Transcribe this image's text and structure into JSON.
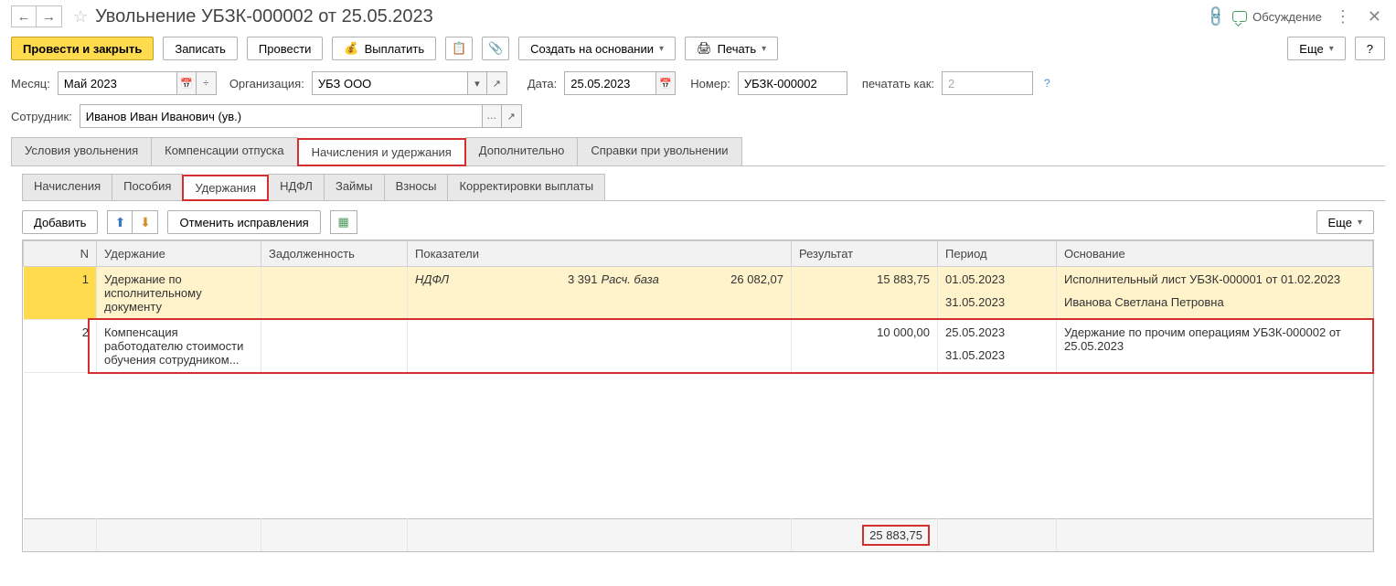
{
  "titlebar": {
    "title": "Увольнение УБЗК-000002 от 25.05.2023",
    "discussion": "Обсуждение"
  },
  "toolbar": {
    "post_close": "Провести и закрыть",
    "record": "Записать",
    "post": "Провести",
    "pay": "Выплатить",
    "create_based": "Создать на основании",
    "print": "Печать",
    "more": "Еще",
    "help": "?"
  },
  "form": {
    "month_label": "Месяц:",
    "month_value": "Май 2023",
    "org_label": "Организация:",
    "org_value": "УБЗ ООО",
    "date_label": "Дата:",
    "date_value": "25.05.2023",
    "number_label": "Номер:",
    "number_value": "УБЗК-000002",
    "print_as_label": "печатать как:",
    "print_as_value": "2",
    "employee_label": "Сотрудник:",
    "employee_value": "Иванов Иван Иванович (ув.)"
  },
  "tabs": {
    "main": [
      "Условия увольнения",
      "Компенсации отпуска",
      "Начисления и удержания",
      "Дополнительно",
      "Справки при увольнении"
    ],
    "sub": [
      "Начисления",
      "Пособия",
      "Удержания",
      "НДФЛ",
      "Займы",
      "Взносы",
      "Корректировки выплаты"
    ]
  },
  "grid_toolbar": {
    "add": "Добавить",
    "cancel_fix": "Отменить исправления",
    "more": "Еще"
  },
  "table": {
    "headers": {
      "n": "N",
      "deduction": "Удержание",
      "debt": "Задолженность",
      "indicators": "Показатели",
      "result": "Результат",
      "period": "Период",
      "basis": "Основание"
    },
    "rows": [
      {
        "n": "1",
        "deduction": "Удержание по исполнительному документу",
        "debt": "",
        "ind_label1": "НДФЛ",
        "ind_val1": "3 391",
        "ind_label2": "Расч. база",
        "ind_val2": "26 082,07",
        "result": "15 883,75",
        "period_from": "01.05.2023",
        "period_to": "31.05.2023",
        "basis_line1": "Исполнительный лист УБЗК-000001 от 01.02.2023",
        "basis_line2": "Иванова Светлана Петровна"
      },
      {
        "n": "2",
        "deduction": "Компенсация работодателю стоимости обучения сотрудником...",
        "debt": "",
        "ind_label1": "",
        "ind_val1": "",
        "ind_label2": "",
        "ind_val2": "",
        "result": "10 000,00",
        "period_from": "25.05.2023",
        "period_to": "31.05.2023",
        "basis_line1": "Удержание по прочим операциям УБЗК-000002 от 25.05.2023",
        "basis_line2": ""
      }
    ],
    "total_result": "25 883,75"
  }
}
